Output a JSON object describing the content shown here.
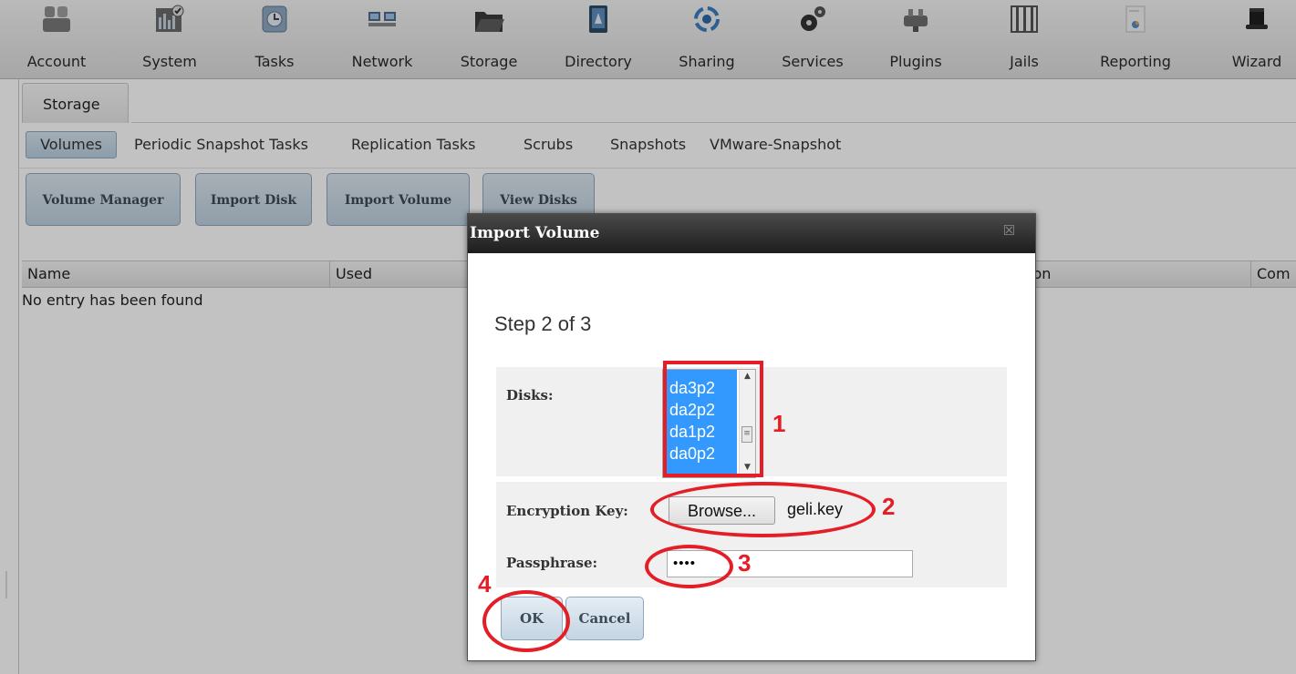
{
  "toolbar": {
    "items": [
      {
        "label": "Account",
        "icon": "account-icon"
      },
      {
        "label": "System",
        "icon": "system-icon"
      },
      {
        "label": "Tasks",
        "icon": "tasks-icon"
      },
      {
        "label": "Network",
        "icon": "network-icon"
      },
      {
        "label": "Storage",
        "icon": "storage-icon"
      },
      {
        "label": "Directory",
        "icon": "directory-icon"
      },
      {
        "label": "Sharing",
        "icon": "sharing-icon"
      },
      {
        "label": "Services",
        "icon": "services-icon"
      },
      {
        "label": "Plugins",
        "icon": "plugins-icon"
      },
      {
        "label": "Jails",
        "icon": "jails-icon"
      },
      {
        "label": "Reporting",
        "icon": "reporting-icon"
      },
      {
        "label": "Wizard",
        "icon": "wizard-icon"
      }
    ]
  },
  "main": {
    "tab": "Storage",
    "subtabs": [
      "Volumes",
      "Periodic Snapshot Tasks",
      "Replication Tasks",
      "Scrubs",
      "Snapshots",
      "VMware-Snapshot"
    ],
    "actions": [
      "Volume Manager",
      "Import Disk",
      "Import Volume",
      "View Disks"
    ],
    "columns": [
      "Name",
      "Used",
      "ion",
      "Com"
    ],
    "empty_message": "No entry has been found"
  },
  "dialog": {
    "title": "Import Volume",
    "close_symbol": "☒",
    "step": "Step 2 of 3",
    "disks_label": "Disks:",
    "disks": [
      "da3p2",
      "da2p2",
      "da1p2",
      "da0p2"
    ],
    "encryption_label": "Encryption Key:",
    "browse_label": "Browse...",
    "file_name": "geli.key",
    "passphrase_label": "Passphrase:",
    "passphrase_value": "••••",
    "ok_label": "OK",
    "cancel_label": "Cancel"
  },
  "annotations": [
    "1",
    "2",
    "3",
    "4"
  ],
  "colors": {
    "annotation": "#e41e26",
    "selection": "#3399ff",
    "button_bg": "#c4d5e3",
    "dialog_title_bg": "#2a2a2a"
  }
}
